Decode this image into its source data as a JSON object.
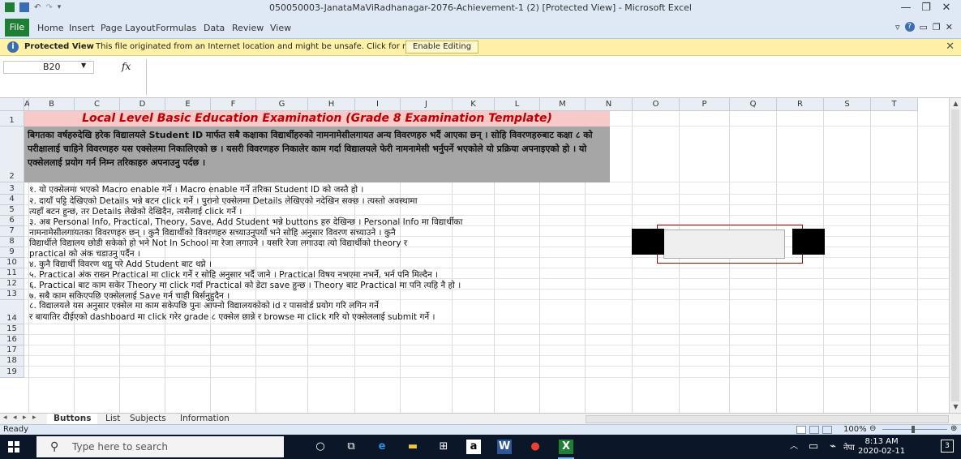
{
  "window": {
    "title": "050050003-JanataMaViRadhanagar-2076-Achievement-1 (2)  [Protected View]  -  Microsoft Excel",
    "min": "—",
    "restore": "❐",
    "close": "✕"
  },
  "ribbon": {
    "tabs": [
      "File",
      "Home",
      "Insert",
      "Page Layout",
      "Formulas",
      "Data",
      "Review",
      "View"
    ]
  },
  "protected_view": {
    "title": "Protected View",
    "message": "This file originated from an Internet location and might be unsafe. Click for more details.",
    "button": "Enable Editing"
  },
  "formula_bar": {
    "name_box": "B20",
    "fx": "fx"
  },
  "columns": [
    "A",
    "B",
    "C",
    "D",
    "E",
    "F",
    "G",
    "H",
    "I",
    "J",
    "K",
    "L",
    "M",
    "N",
    "O",
    "P",
    "Q",
    "R",
    "S",
    "T"
  ],
  "rows": [
    "1",
    "2",
    "3",
    "4",
    "5",
    "6",
    "7",
    "8",
    "9",
    "10",
    "11",
    "12",
    "13",
    "14",
    "15",
    "16",
    "17",
    "18",
    "19"
  ],
  "sheet": {
    "title": "Local Level Basic Education Examination (Grade 8 Examination Template)",
    "intro": "बिगतका वर्षहरुदेखि हरेक विद्यालयले Student ID मार्फत सबै कक्षाका विद्यार्थीहरुको नामनामेसीलगायत अन्य विवरणहरु भर्दै आएका छन् । सोहि विवरणहरुबाट कक्षा ८ को परीक्षालाई चाहिने विवरणहरु यस एक्सेलमा निकालिएको छ । यसरी विवरणहरु निकालेर काम गर्दा विद्यालयले फेरी नामनामेसी भर्नुपर्ने भएकोले यो प्रक्रिया अपनाइएको हो । यो एक्सेललाई प्रयोग गर्न निम्न तरिकाहरु अपनाउनु पर्दछ ।",
    "lines": [
      "१. यो एक्सेलमा भएको Macro enable गर्ने । Macro enable गर्ने तरिका Student ID को जस्तै हो ।",
      "२. दायाँ पट्टि देखिएको Details भन्ने बटन click गर्ने । पुरानो एक्सेलमा Details लेखिएको नदेखिन सक्छ । त्यस्तो अवस्थामा",
      "त्यहाँ बटन हुन्छ, तर Details लेखेको देखिदैन, त्यसैलाई click गर्ने ।",
      "३. अब Personal Info, Practical, Theory, Save, Add Student भन्ने buttons हरु देखिन्छ । Personal Info मा विद्यार्थीका",
      "नामनामेसीलगायतका विवरणहरु छन् । कुनै विद्यार्थीको विवरणहरु सच्याउनुपर्यो भने सोहि अनुसार विवरण सच्याउने । कुनै",
      "विद्यार्थीले विद्यालय छोडी सकेको हो भने Not In School मा रेजा लगाउने । यसरि रेजा लगाउदा त्यो विद्यार्थीको theory र",
      "practical को अंक चडाउनु पर्दैन ।",
      "४. कुनै विद्यार्थी विवरण थप्नु परे Add Student बाट थप्ने ।",
      "५. Practical अंक राख्न Practical मा click गर्ने र सोहि अनुसार भर्दै जाने । Practical विषय नभएमा नभर्ने, भर्न पनि मिल्दैन ।",
      "६. Practical बाट काम सकेर Theory मा click गर्दा Practical को डेटा save हुन्छ । Theory बाट Practical मा पनि त्यहि नै हो ।",
      "७. सबै काम सकिएपछि एक्सेललाई Save गर्न चाही बिर्सनुहुदैन ।",
      "८. विद्यालयले यस अनुसार एक्सेल मा काम सकेपछि पुनः आफ्नो विद्यालयकोको id र पासवोर्ड प्रयोग गरि लगिन गर्ने",
      "र बायातिर दीईएको dashboard मा click गरेर grade ८ एक्सेल छान्ने र browse मा click गरि यो एक्सेललाई submit गर्ने ।"
    ]
  },
  "sheet_tabs": [
    "Buttons",
    "List",
    "Subjects",
    "Information"
  ],
  "status": {
    "ready": "Ready",
    "zoom": "100%"
  },
  "taskbar": {
    "search_placeholder": "Type here to search",
    "time": "8:13 AM",
    "date": "2020-02-11",
    "lang": "नेपा",
    "notifications": "3"
  },
  "colors": {
    "accent": "#1e7e34",
    "title_red": "#c00000",
    "title_fill": "#f8c9c9",
    "intro_fill": "#a6a6a6"
  },
  "icons": [
    "excel-icon",
    "save-icon",
    "undo-icon",
    "redo-icon",
    "help-icon",
    "info-icon",
    "windows-start-icon",
    "search-icon",
    "cortana-icon",
    "task-view-icon",
    "edge-icon",
    "file-explorer-icon",
    "store-icon",
    "amazon-icon",
    "word-icon",
    "chrome-icon",
    "excel-taskbar-icon"
  ]
}
